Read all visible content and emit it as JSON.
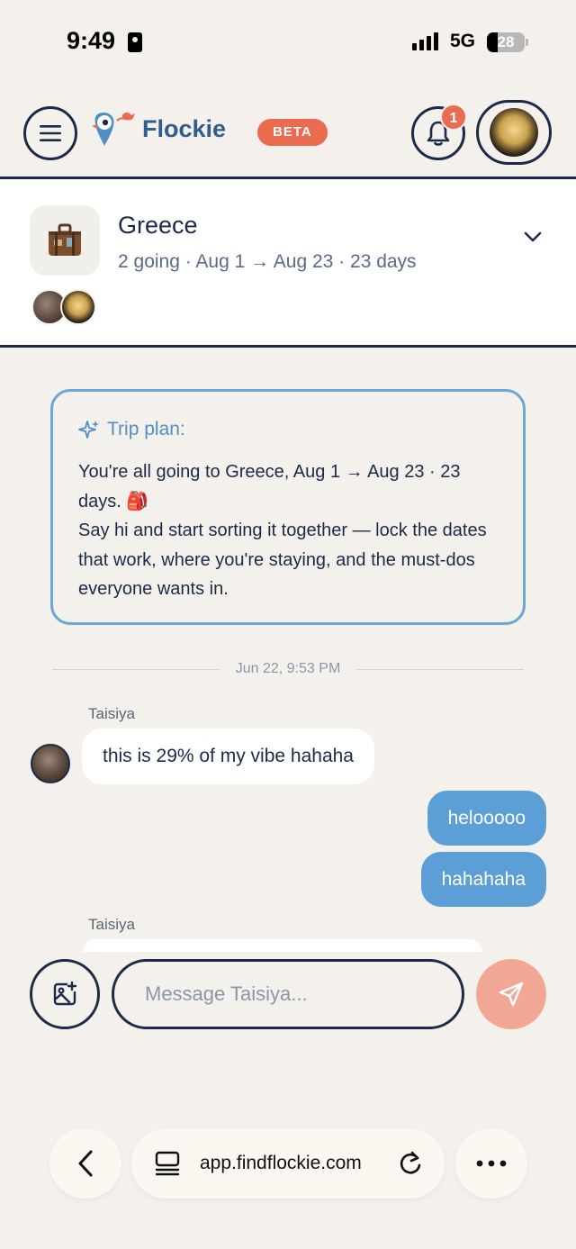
{
  "status_bar": {
    "time": "9:49",
    "network": "5G",
    "battery": "28",
    "battery_level": 0.28
  },
  "header": {
    "brand": "Flockie",
    "beta_label": "BETA",
    "notification_count": "1"
  },
  "trip": {
    "title": "Greece",
    "meta": "2 going · Aug 1 → Aug 23 · 23 days",
    "icon": "suitcase-icon"
  },
  "plan": {
    "title": "Trip plan:",
    "line1": "You're all going to Greece, Aug 1 → Aug 23 · 23 days. 🎒",
    "line2": "Say hi and start sorting it together — lock the dates that work, where you're staying, and the must-dos everyone wants in."
  },
  "chat": {
    "timestamp": "Jun 22, 9:53 PM",
    "messages": [
      {
        "sender": "Taisiya",
        "text": "this is 29% of my vibe hahaha",
        "direction": "in"
      },
      {
        "sender": "me",
        "text": "helooooo",
        "direction": "out"
      },
      {
        "sender": "me",
        "text": "hahahaha",
        "direction": "out"
      },
      {
        "sender": "Taisiya",
        "text": "",
        "direction": "in"
      }
    ]
  },
  "composer": {
    "placeholder": "Message Taisiya..."
  },
  "browser": {
    "url": "app.findflockie.com"
  },
  "colors": {
    "accent": "#ea6b4f",
    "navy": "#1c2a4a",
    "bubble_out": "#5b9fd6",
    "plan_border": "#6aa6d6",
    "background": "#f4f1ec"
  }
}
